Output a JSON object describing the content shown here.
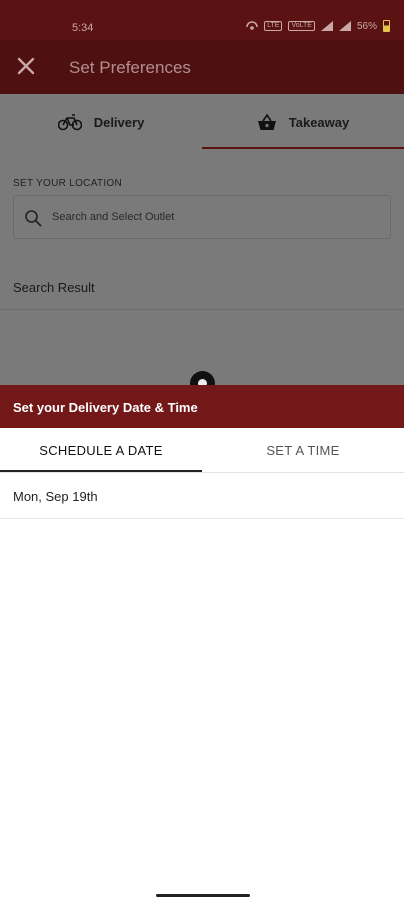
{
  "status_bar": {
    "time": "5:34",
    "net_badge_1": "LTE",
    "net_badge_2": "VoLTE",
    "battery": "56%"
  },
  "app_bar": {
    "title": "Set Preferences",
    "close_icon": "close-icon"
  },
  "preference_tabs": [
    {
      "label": "Delivery",
      "icon": "bicycle-icon",
      "selected": false
    },
    {
      "label": "Takeaway",
      "icon": "basket-icon",
      "selected": true
    }
  ],
  "location": {
    "section_label": "SET YOUR LOCATION",
    "search_placeholder": "Search and Select Outlet",
    "result_title": "Search Result"
  },
  "sheet": {
    "title": "Set your Delivery Date & Time",
    "tabs": [
      {
        "label": "SCHEDULE A DATE",
        "selected": true
      },
      {
        "label": "SET A TIME",
        "selected": false
      }
    ],
    "date_value": "Mon, Sep 19th"
  },
  "colors": {
    "brand": "#731818",
    "app_bar": "#4e1010",
    "overlay": "#7a7a7a"
  }
}
